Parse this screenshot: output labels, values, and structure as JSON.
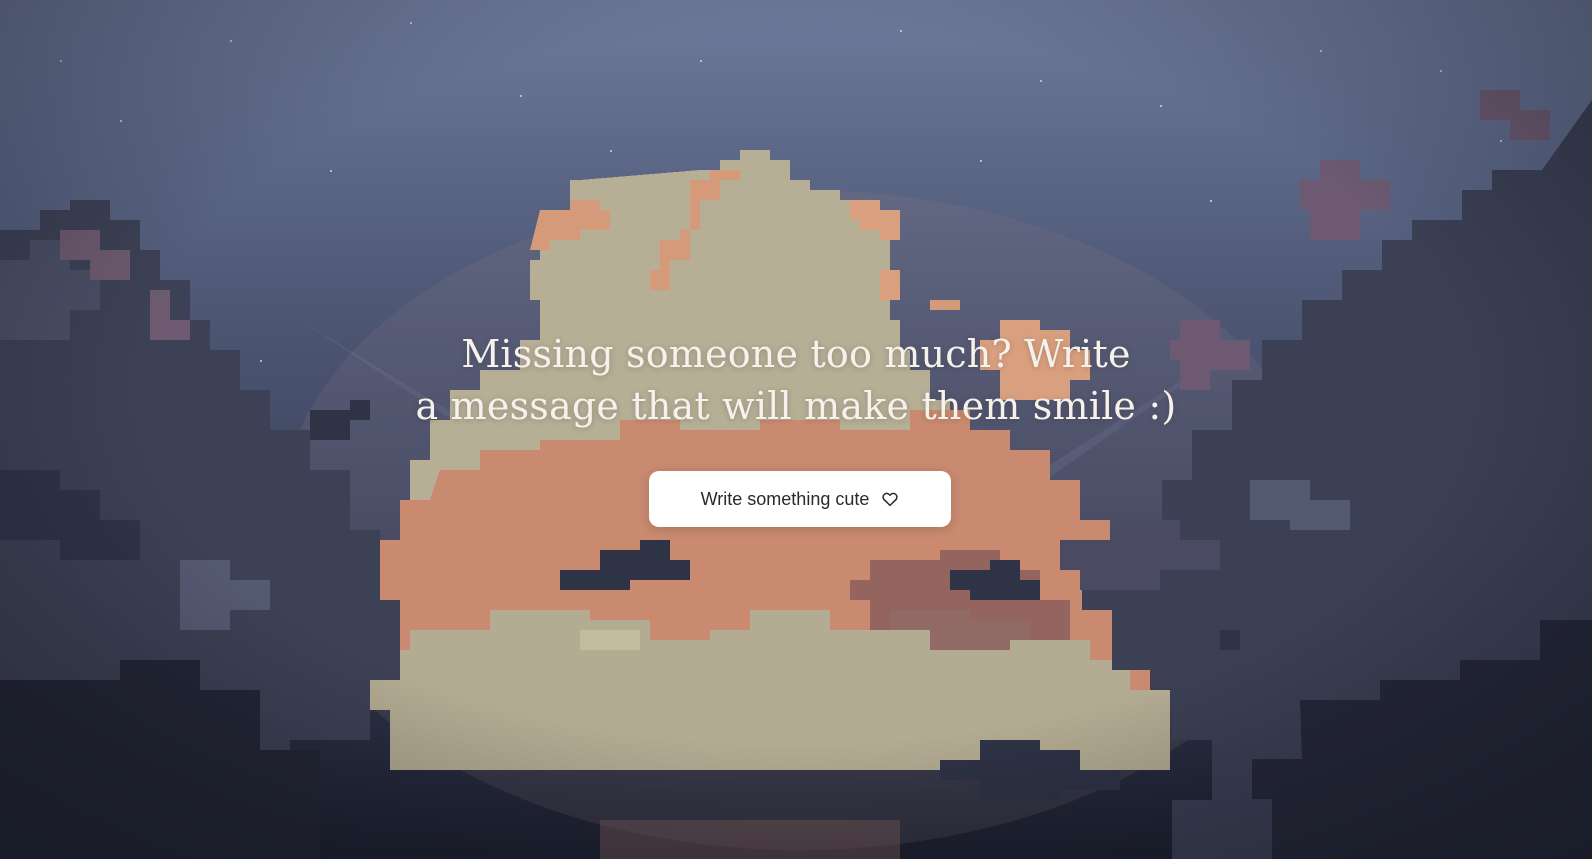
{
  "hero": {
    "headline_line1": "Missing someone too much? Write",
    "headline_line2": "a message that will make them smile :)",
    "cta_label": "Write something cute",
    "cta_icon": "heart-icon"
  },
  "colors": {
    "sky_top": "#6f7b9c",
    "sky_bottom": "#1d2030",
    "cloud_cream": "#b9b197",
    "cloud_peach": "#d49a7a",
    "cloud_dark": "#3a3f52",
    "button_bg": "#ffffff",
    "button_text": "#2a2a2e",
    "headline_text": "#f6f1ea"
  }
}
